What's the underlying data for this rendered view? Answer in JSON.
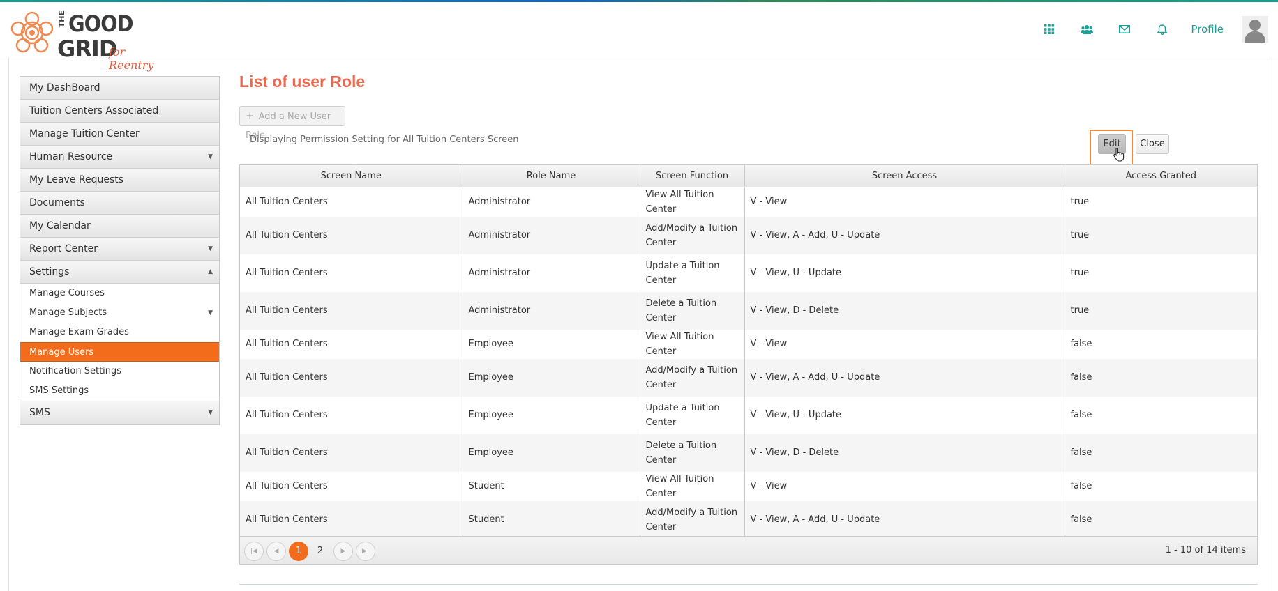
{
  "header": {
    "logo": {
      "the": "THE",
      "good": "GOOD",
      "grid": "GRID",
      "tagline": "for Reentry"
    },
    "icons": [
      "apps-grid-icon",
      "users-icon",
      "mail-icon",
      "bell-icon"
    ],
    "profile_label": "Profile"
  },
  "sidebar": {
    "items": [
      {
        "label": "My DashBoard"
      },
      {
        "label": "Tuition Centers Associated"
      },
      {
        "label": "Manage Tuition Center"
      },
      {
        "label": "Human Resource",
        "arrow": "▼"
      },
      {
        "label": "My Leave Requests"
      },
      {
        "label": "Documents"
      },
      {
        "label": "My Calendar"
      },
      {
        "label": "Report Center",
        "arrow": "▼"
      },
      {
        "label": "Settings",
        "arrow": "▲"
      }
    ],
    "settings_sub": [
      {
        "label": "Manage Courses"
      },
      {
        "label": "Manage Subjects",
        "arrow": "▼"
      },
      {
        "label": "Manage Exam Grades"
      },
      {
        "label": "Manage Users"
      },
      {
        "label": "Notification Settings"
      },
      {
        "label": "SMS Settings"
      }
    ],
    "sms": {
      "label": "SMS",
      "arrow": "▼"
    }
  },
  "main": {
    "title": "List of user Role",
    "add_button": "Add a New User Role",
    "caption": "Displaying Permission Setting for All Tuition Centers Screen",
    "edit_button": "Edit",
    "close_button": "Close",
    "columns": [
      "Screen Name",
      "Role Name",
      "Screen Function",
      "Screen Access",
      "Access Granted"
    ],
    "rows": [
      [
        "All Tuition Centers",
        "Administrator",
        "View All Tuition Center",
        "V - View",
        "true"
      ],
      [
        "All Tuition Centers",
        "Administrator",
        "Add/Modify a Tuition Center",
        "V - View, A - Add, U - Update",
        "true"
      ],
      [
        "All Tuition Centers",
        "Administrator",
        "Update a Tuition Center",
        "V - View, U - Update",
        "true"
      ],
      [
        "All Tuition Centers",
        "Administrator",
        "Delete a Tuition Center",
        "V - View, D - Delete",
        "true"
      ],
      [
        "All Tuition Centers",
        "Employee",
        "View All Tuition Center",
        "V - View",
        "false"
      ],
      [
        "All Tuition Centers",
        "Employee",
        "Add/Modify a Tuition Center",
        "V - View, A - Add, U - Update",
        "false"
      ],
      [
        "All Tuition Centers",
        "Employee",
        "Update a Tuition Center",
        "V - View, U - Update",
        "false"
      ],
      [
        "All Tuition Centers",
        "Employee",
        "Delete a Tuition Center",
        "V - View, D - Delete",
        "false"
      ],
      [
        "All Tuition Centers",
        "Student",
        "View All Tuition Center",
        "V - View",
        "false"
      ],
      [
        "All Tuition Centers",
        "Student",
        "Add/Modify a Tuition Center",
        "V - View, A - Add, U - Update",
        "false"
      ]
    ],
    "pager": {
      "pages": [
        "1",
        "2"
      ],
      "current": "1",
      "info": "1 - 10 of 14 items"
    }
  },
  "colors": {
    "accent": "#f26c1c",
    "teal": "#1aa198",
    "title": "#e86a50"
  }
}
